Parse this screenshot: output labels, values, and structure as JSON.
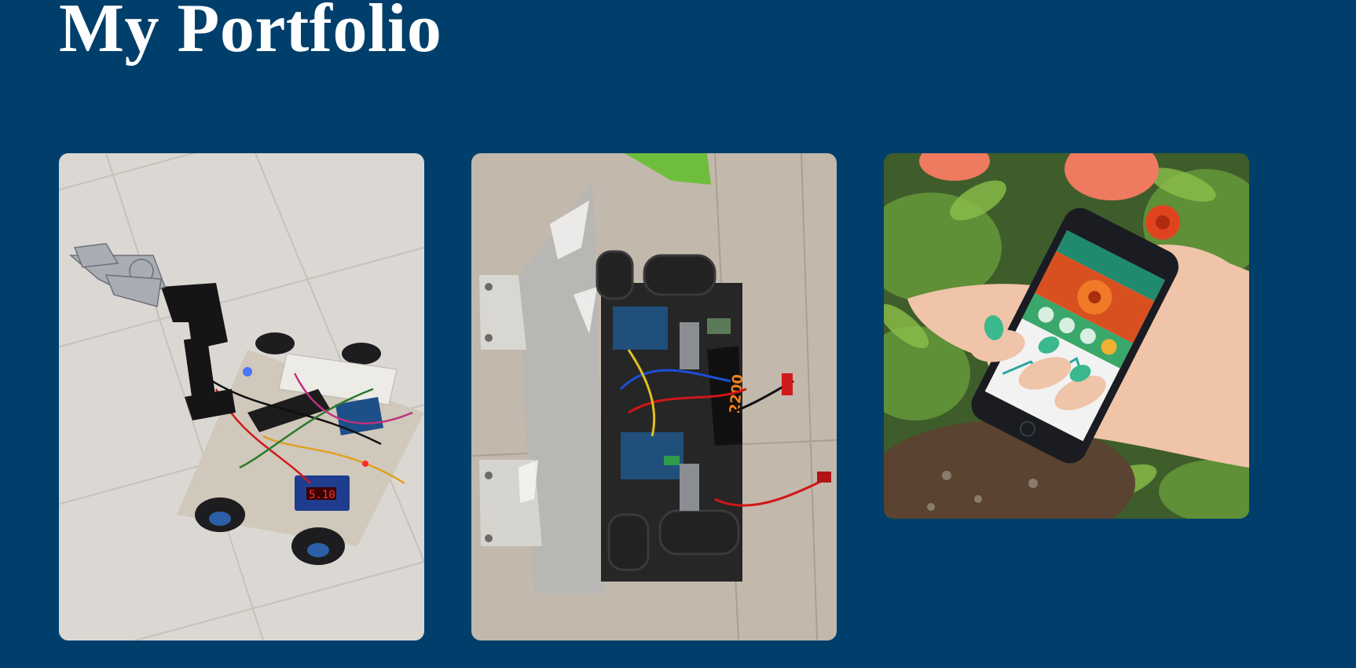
{
  "header": {
    "title": "My Portfolio"
  },
  "projects": [
    {
      "image": "robot-arm-car-photo"
    },
    {
      "image": "robot-chassis-photo"
    },
    {
      "image": "plant-app-phone-photo"
    }
  ],
  "colors": {
    "background": "#003f6b",
    "title": "#ffffff"
  }
}
